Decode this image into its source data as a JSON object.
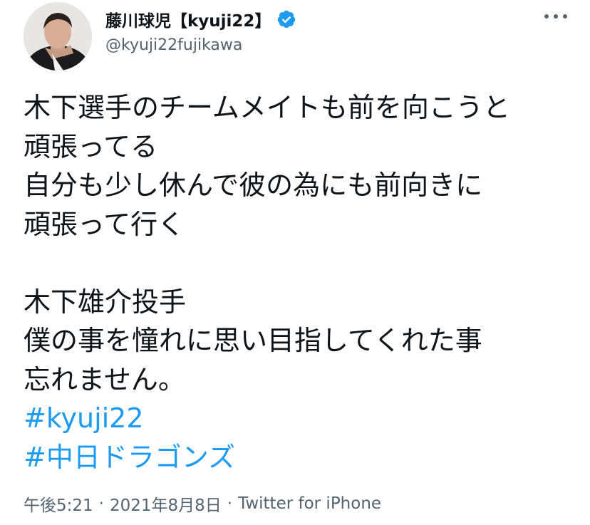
{
  "author": {
    "display_name": "藤川球児【kyuji22】",
    "handle": "@kyuji22fujikawa",
    "verified": true,
    "verified_icon": "verified-badge-icon",
    "avatar_icon": "avatar"
  },
  "more_icon": "more-options-icon",
  "body": {
    "lines": [
      "木下選手のチームメイトも前を向こうと",
      "頑張ってる",
      "自分も少し休んで彼の為にも前向きに",
      "頑張って行く",
      "",
      "木下雄介投手",
      "僕の事を憧れに思い目指してくれた事",
      "忘れません。"
    ],
    "hashtags": [
      "#kyuji22",
      "#中日ドラゴンズ"
    ]
  },
  "meta": {
    "time": "午後5:21",
    "separator": "·",
    "date": "2021年8月8日",
    "source": "Twitter for iPhone"
  },
  "colors": {
    "text": "#0f1419",
    "secondary": "#536471",
    "link": "#1d9bf0",
    "verified": "#1d9bf0"
  }
}
